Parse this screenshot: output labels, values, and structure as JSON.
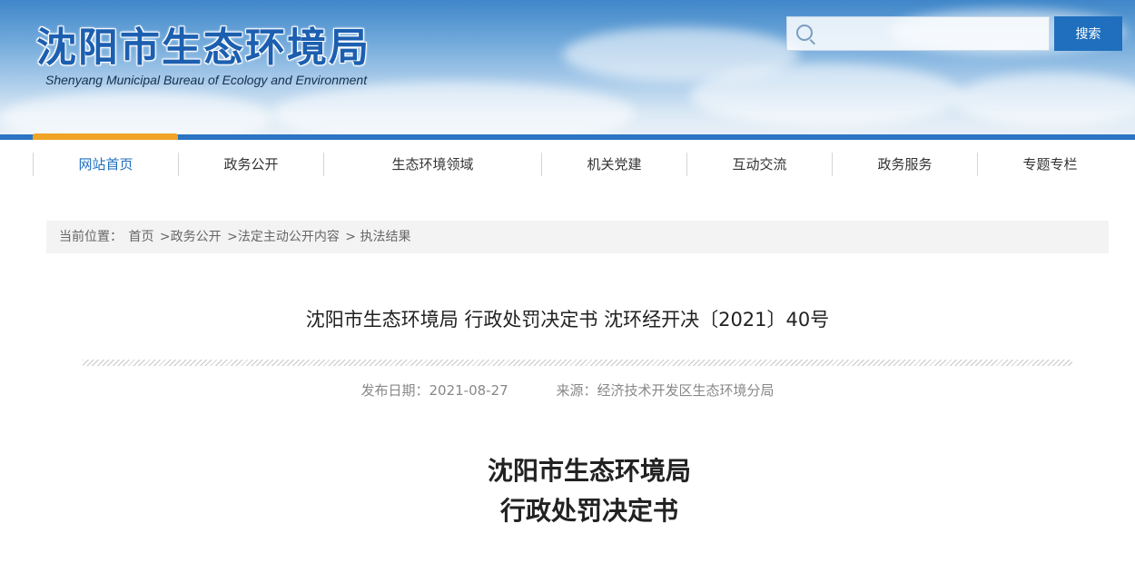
{
  "header": {
    "title": "沈阳市生态环境局",
    "subtitle": "Shenyang Municipal Bureau of Ecology and Environment",
    "search_placeholder": "",
    "search_button": "搜索"
  },
  "nav": {
    "active_index": 0,
    "items": [
      {
        "label": "网站首页"
      },
      {
        "label": "政务公开"
      },
      {
        "label": "生态环境领域"
      },
      {
        "label": "机关党建"
      },
      {
        "label": "互动交流"
      },
      {
        "label": "政务服务"
      },
      {
        "label": "专题专栏"
      }
    ]
  },
  "breadcrumb": {
    "prefix": "当前位置：",
    "items": [
      "首页",
      ">政务公开",
      ">法定主动公开内容",
      "> 执法结果"
    ]
  },
  "article": {
    "title": "沈阳市生态环境局 行政处罚决定书 沈环经开决〔2021〕40号",
    "publish_date": "发布日期：2021-08-27",
    "source": "来源：经济技术开发区生态环境分局",
    "heading_line1": "沈阳市生态环境局",
    "heading_line2": "行政处罚决定书"
  },
  "colors": {
    "accent": "#1f6fbe",
    "nav_active": "#f0a325"
  }
}
